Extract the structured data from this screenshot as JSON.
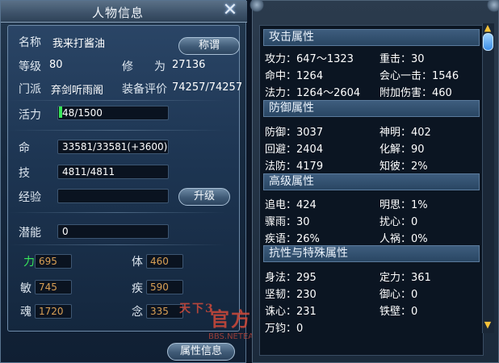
{
  "window": {
    "title": "人物信息",
    "close_icon": "close-icon"
  },
  "character": {
    "name_label": "名称",
    "name_value": "我来打酱油",
    "title_button": "称谓",
    "level_label": "等级",
    "level_value": "80",
    "cultivation_label": "修",
    "cultivation_label2": "为",
    "cultivation_value": "27136",
    "sect_label": "门派",
    "sect_value": "弃剑听雨阁",
    "equip_rating_label": "装备评价",
    "equip_rating_value": "74257/74257",
    "vitality_label": "活力",
    "vitality_value": "48/1500",
    "vitality_fraction": 0.032,
    "hp_label": "命",
    "hp_value": "33581/33581(+3600)",
    "skill_label": "技",
    "skill_value": "4811/4811",
    "exp_label": "经验",
    "exp_value": "",
    "upgrade_button": "升级",
    "potential_label": "潜能",
    "potential_value": "0",
    "stats": {
      "strength_label": "力",
      "strength_value": "695",
      "constitution_label": "体",
      "constitution_value": "460",
      "agility_label": "敏",
      "agility_value": "745",
      "speed_label": "疾",
      "speed_value": "590",
      "soul_label": "魂",
      "soul_value": "1720",
      "mind_label": "念",
      "mind_value": "335"
    },
    "attr_info_button": "属性信息"
  },
  "attributes": {
    "attack": {
      "header": "攻击属性",
      "attack_power": "攻力：647～1323",
      "heavy_hit": "重击：30",
      "accuracy": "命中：1264",
      "critical": "会心一击：1546",
      "magic_power": "法力：1264～2604",
      "extra_damage": "附加伤害：460"
    },
    "defense": {
      "header": "防御属性",
      "defense": "防御：3037",
      "divine": "神明：402",
      "evasion": "回避：2404",
      "dissolve": "化解：90",
      "magic_defense": "法防：4179",
      "insight": "知彼：2%"
    },
    "advanced": {
      "header": "高级属性",
      "chase": "追电：424",
      "clear_thought": "明思：1%",
      "sudden_rain": "骤雨：30",
      "disturb": "扰心：0",
      "swift_words": "疾语：26%",
      "human_calamity": "人祸：0%"
    },
    "special": {
      "header": "抗性与特殊属性",
      "body_method": "身法：295",
      "fixed_force": "定力：361",
      "toughness": "坚韧：230",
      "mind_guard": "御心：0",
      "soul_seduce": "诛心：231",
      "iron_wall": "铁壁：0",
      "wan_jun": "万钧：0"
    }
  },
  "watermark": {
    "logo_text": "天下3",
    "site_text": "官方论坛",
    "url": "BBS.NETEASE.COM"
  },
  "colors": {
    "stat_value": "#d9a055",
    "strength_label": "#38e65a",
    "vitality_fill": "#38e65a",
    "watermark": "#d24a3a"
  }
}
